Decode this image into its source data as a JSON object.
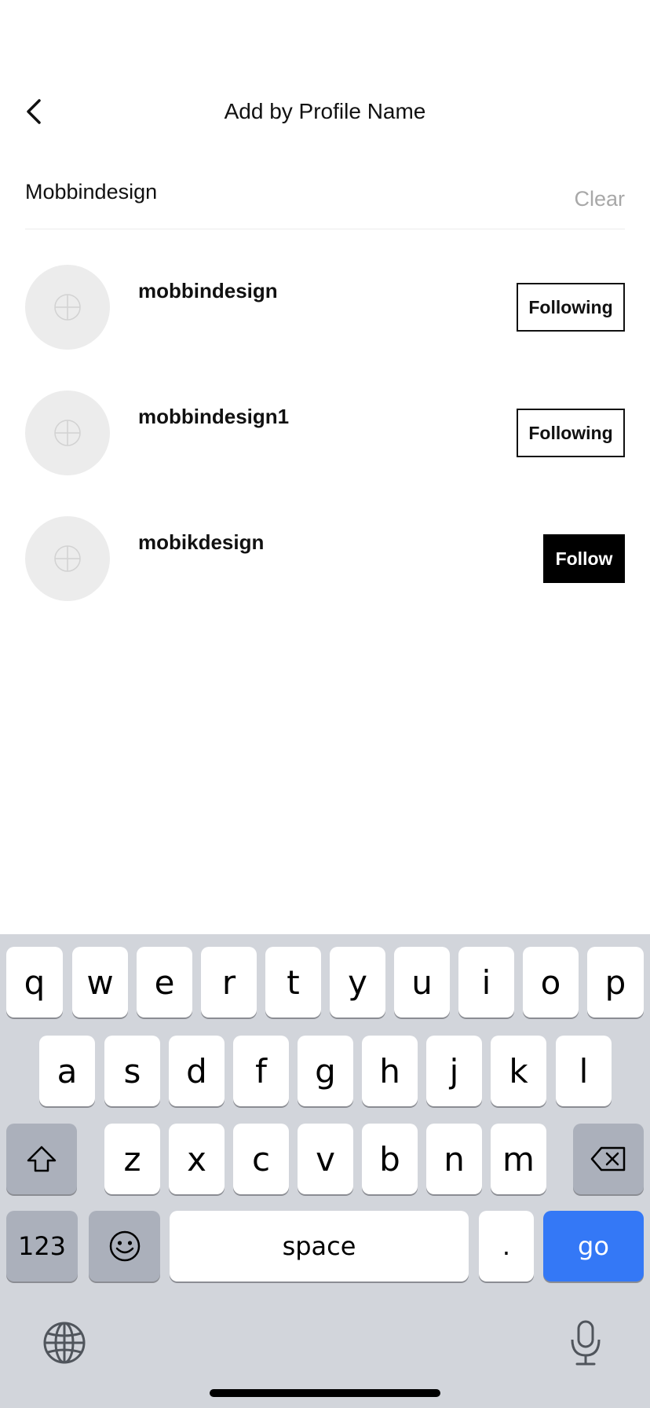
{
  "header": {
    "title": "Add by Profile Name",
    "back_icon": "chevron-left-icon"
  },
  "search": {
    "value": "Mobbindesign",
    "clear_label": "Clear"
  },
  "results": [
    {
      "username": "mobbindesign",
      "action_label": "Following",
      "state": "following"
    },
    {
      "username": "mobbindesign1",
      "action_label": "Following",
      "state": "following"
    },
    {
      "username": "mobikdesign",
      "action_label": "Follow",
      "state": "not-following"
    }
  ],
  "keyboard": {
    "row1": [
      "q",
      "w",
      "e",
      "r",
      "t",
      "y",
      "u",
      "i",
      "o",
      "p"
    ],
    "row2": [
      "a",
      "s",
      "d",
      "f",
      "g",
      "h",
      "j",
      "k",
      "l"
    ],
    "row3": [
      "z",
      "x",
      "c",
      "v",
      "b",
      "n",
      "m"
    ],
    "numbers_label": "123",
    "space_label": "space",
    "period_label": ".",
    "go_label": "go",
    "accent_color": "#3478f6"
  }
}
